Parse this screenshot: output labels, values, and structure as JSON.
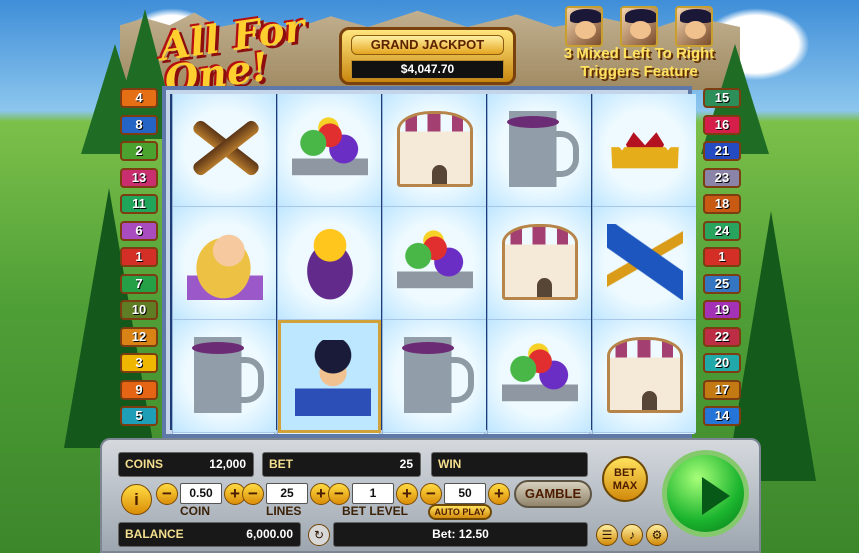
{
  "header": {
    "logo_line1": "All For",
    "logo_line2": "One!",
    "jackpot_title": "GRAND JACKPOT",
    "jackpot_amount": "$4,047.70",
    "feature_line1": "3 Mixed Left To Right",
    "feature_line2": "Triggers Feature"
  },
  "paylines_left": [
    "4",
    "8",
    "2",
    "13",
    "11",
    "6",
    "1",
    "7",
    "10",
    "12",
    "3",
    "9",
    "5"
  ],
  "paylines_right": [
    "15",
    "16",
    "21",
    "23",
    "18",
    "24",
    "1",
    "25",
    "19",
    "22",
    "20",
    "17",
    "14"
  ],
  "reels": [
    [
      "crossed-pistols",
      "lady",
      "mug"
    ],
    [
      "fruit-bowl",
      "gold-bag",
      "musketeer"
    ],
    [
      "castle",
      "fruit-bowl",
      "mug"
    ],
    [
      "mug",
      "castle",
      "fruit-bowl"
    ],
    [
      "crown",
      "horn-flag",
      "castle"
    ]
  ],
  "controls": {
    "coins_label": "COINS",
    "coins_value": "12,000",
    "bet_label": "BET",
    "bet_value": "25",
    "win_label": "WIN",
    "coin_label": "COIN",
    "coin_value": "0.50",
    "lines_label": "LINES",
    "lines_value": "25",
    "bet_level_label": "BET LEVEL",
    "bet_level_value": "1",
    "auto_play_value": "50",
    "auto_play_label": "AUTO PLAY",
    "bet_max_line1": "BET",
    "bet_max_line2": "MAX",
    "gamble_label": "GAMBLE",
    "balance_label": "BALANCE",
    "balance_value": "6,000.00",
    "bet_summary": "Bet: 12.50"
  }
}
